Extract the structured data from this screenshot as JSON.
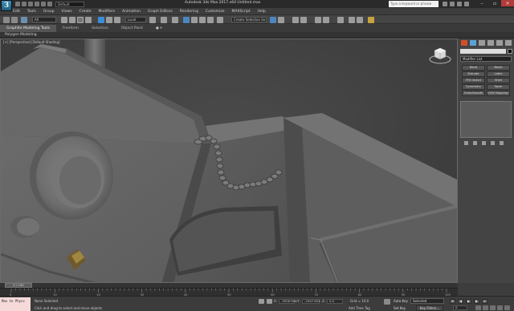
{
  "window": {
    "title": "Autodesk 3ds Max 2017.x64    Untitled.max",
    "search_placeholder": "Type a keyword or phrase",
    "workspace_value": "Default"
  },
  "menus": [
    "Edit",
    "Tools",
    "Group",
    "Views",
    "Create",
    "Modifiers",
    "Animation",
    "Graph Editors",
    "Rendering",
    "Customize",
    "MAXScript",
    "Help"
  ],
  "toolbar": {
    "selection_filter": "All",
    "ref_coord": "Local",
    "named_selection": "Create Selection Se"
  },
  "ribbon": {
    "tabs": [
      "Graphite Modeling Tools",
      "Freeform",
      "Selection",
      "Object Paint"
    ],
    "panel_label": "Polygon Modeling"
  },
  "viewport": {
    "label": "[+] [Perspective] [Default Shading]"
  },
  "command_panel": {
    "modifier_list_label": "Modifier List",
    "modifier_buttons": [
      "Bend",
      "Bevel",
      "Extrude",
      "Lathe",
      "FFD 4x4x4",
      "Shell",
      "Symmetry",
      "Taper",
      "TurboSmooth",
      "UVW Mapping Clr"
    ],
    "object_color": "#000000"
  },
  "timeline": {
    "slider_label": "0 / 100",
    "ticks": [
      "0",
      "10",
      "20",
      "30",
      "40",
      "50",
      "60",
      "70",
      "80",
      "90",
      "100"
    ]
  },
  "status": {
    "maxscript_text": "Max to Physc",
    "selection_text": "None Selected",
    "prompt_text": "Click and drag to select and move objects",
    "x_label": "X:",
    "x_value": "-3506.909",
    "y_label": "Y:",
    "y_value": "-2097.603",
    "z_label": "Z:",
    "z_value": "0.0",
    "grid_text": "Grid = 10.0",
    "add_time_tag": "Add Time Tag",
    "auto_key": "Auto Key",
    "auto_key_value": "Selected",
    "set_key": "Set Key",
    "key_filters": "Key Filters...",
    "frame_value": "0"
  },
  "colors": {
    "close_button": "#b33a3a",
    "maxscript_bg": "#f6dada",
    "viewport_bg": "#424242"
  }
}
